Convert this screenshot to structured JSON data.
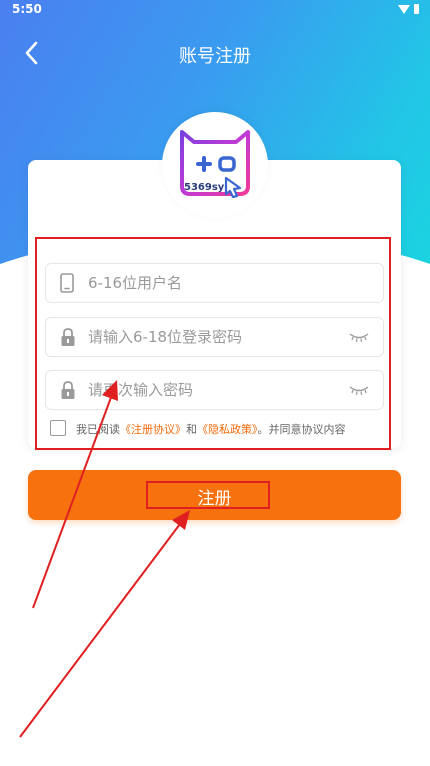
{
  "status_bar": {
    "time": "5:50"
  },
  "header": {
    "title": "账号注册"
  },
  "logo": {
    "text": "5369sy"
  },
  "form": {
    "username_placeholder": "6-16位用户名",
    "password_placeholder": "请输入6-18位登录密码",
    "confirm_placeholder": "请再次输入密码"
  },
  "agreement": {
    "prefix": "我已阅读",
    "link1": "《注册协议》",
    "and": "和",
    "link2": "《隐私政策》",
    "suffix": "。并同意协议内容"
  },
  "register_button": {
    "label": "注册"
  },
  "colors": {
    "accent": "#f7720f",
    "annotation": "#e02020"
  },
  "icons": {
    "back": "back-arrow-icon",
    "phone": "phone-icon",
    "lock": "lock-icon",
    "eye": "eye-closed-icon",
    "wifi": "wifi-icon",
    "battery": "battery-icon"
  }
}
